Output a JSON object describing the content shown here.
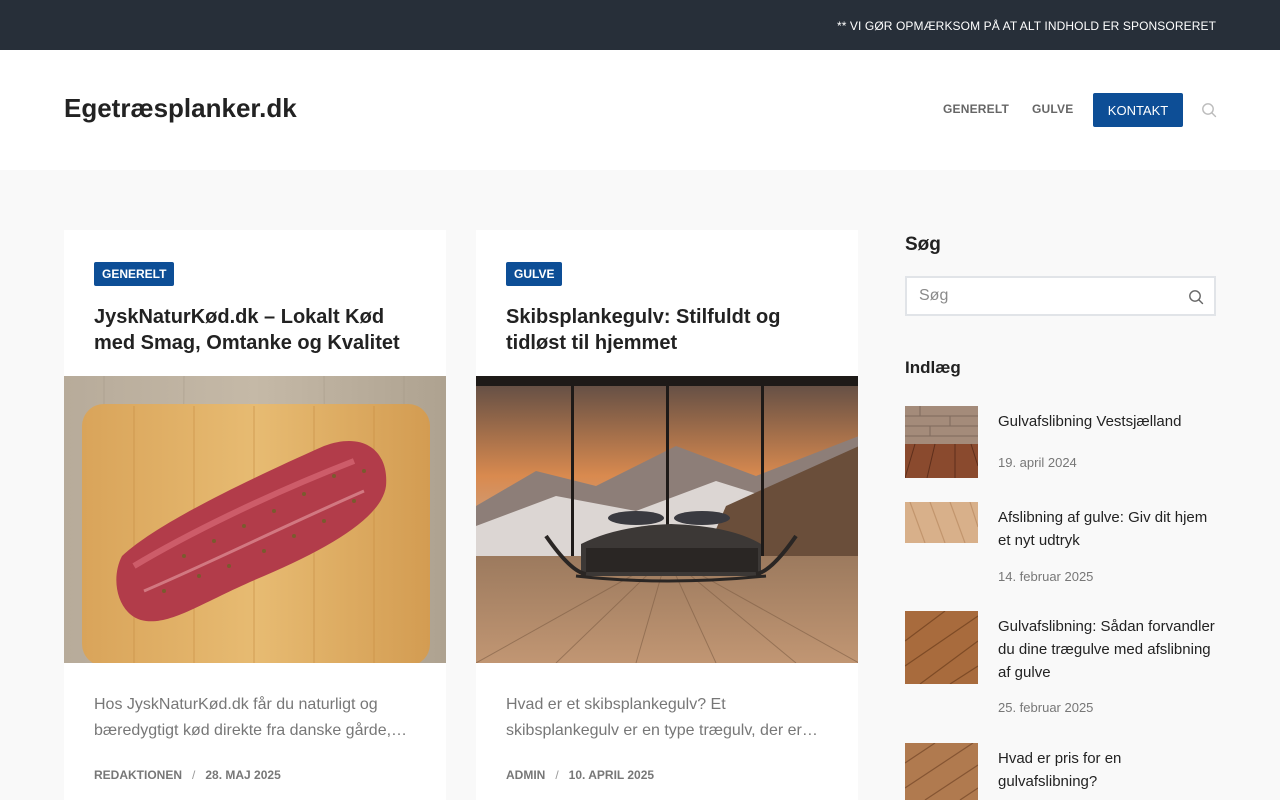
{
  "topbar": {
    "notice": "** VI GØR OPMÆRKSOM PÅ AT ALT INDHOLD ER SPONSORERET"
  },
  "header": {
    "site_title": "Egetræsplanker.dk",
    "nav": [
      "GENERELT",
      "GULVE"
    ],
    "contact_label": "KONTAKT"
  },
  "cards": [
    {
      "category": "GENERELT",
      "title": "JyskNaturKød.dk – Lokalt Kød med Smag, Omtanke og Kvalitet",
      "excerpt": "Hos JyskNaturKød.dk får du naturligt og bæredygtigt kød direkte fra danske gårde,…",
      "author": "REDAKTIONEN",
      "date": "28. MAJ 2025"
    },
    {
      "category": "GULVE",
      "title": "Skibsplankegulv: Stilfuldt og tidløst til hjemmet",
      "excerpt": "Hvad er et skibsplankegulv? Et skibsplankegulv er en type trægulv, der er…",
      "author": "ADMIN",
      "date": "10. APRIL 2025"
    }
  ],
  "sidebar": {
    "search_heading": "Søg",
    "search_placeholder": "Søg",
    "posts_heading": "Indlæg",
    "posts": [
      {
        "title": "Gulvafslibning Vestsjælland",
        "date": "19. april 2024"
      },
      {
        "title": "Afslibning af gulve: Giv dit hjem et nyt udtryk",
        "date": "14. februar 2025"
      },
      {
        "title": "Gulvafslibning: Sådan forvandler du dine trægulve med afslibning af gulve",
        "date": "25. februar 2025"
      },
      {
        "title": "Hvad er pris for en gulvafslibning?",
        "date": ""
      }
    ]
  },
  "colors": {
    "topbar": "#272f39",
    "accent": "#0d4e96"
  }
}
